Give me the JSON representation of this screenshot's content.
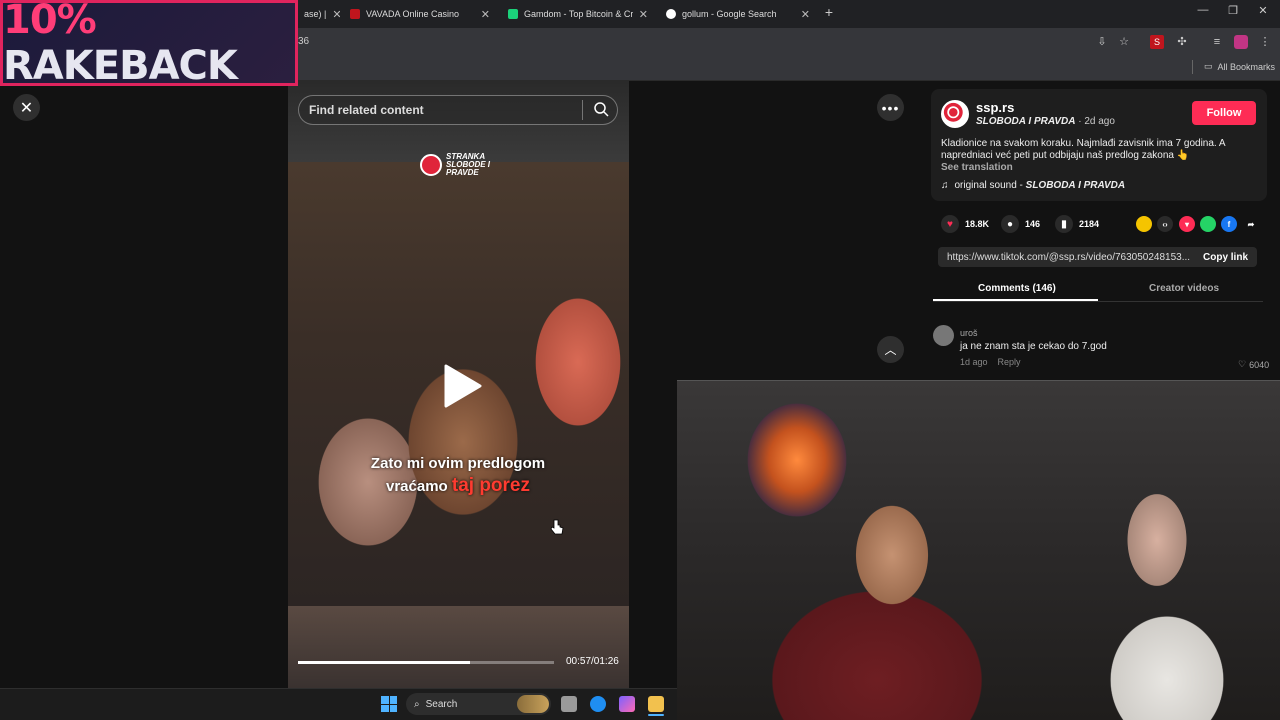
{
  "browser": {
    "tabs": [
      {
        "label": "ase) |",
        "active": false
      },
      {
        "label": "VAVADA Online Casino",
        "active": false
      },
      {
        "label": "Gamdom - Top Bitcoin & Crypto",
        "active": false
      },
      {
        "label": "gollum - Google Search",
        "active": true
      }
    ],
    "new_tab": "+",
    "url_fragment": "36",
    "bookmarks_label": "All Bookmarks"
  },
  "overlay": {
    "rakeback_pct": "10%",
    "rakeback_word": "RAKEBACK"
  },
  "video": {
    "search_placeholder": "Find related content",
    "logo_lines": [
      "STRANKA",
      "SLOBODE I",
      "PRAVDE"
    ],
    "subtitle_line1": "Zato mi ovim predlogom",
    "subtitle_line2_a": "vraćamo",
    "subtitle_line2_b": "taj porez",
    "time": "00:57/01:26",
    "progress": 0.67
  },
  "post": {
    "author": "ssp.rs",
    "nickname": "SLOBODA I PRAVDA",
    "posted": "· 2d ago",
    "follow_label": "Follow",
    "description": "Kladionice na svakom koraku. Najmlađi zavisnik ima 7 godina. A napredniaci već peti put odbijaju naš predlog zakona 👆",
    "see_translation": "See translation",
    "sound_prefix": "original sound -",
    "likes": "18.8K",
    "comments": "146",
    "saves": "2184",
    "link": "https://www.tiktok.com/@ssp.rs/video/763050248153...",
    "copy_link": "Copy link",
    "tab_comments": "Comments (146)",
    "tab_creator": "Creator videos"
  },
  "comment": {
    "user": "uroš",
    "text": "ja ne znam sta je cekao do 7.god",
    "age": "1d ago",
    "reply": "Reply",
    "likes": "6040"
  },
  "taskbar": {
    "search_label": "Search"
  },
  "colors": {
    "accent": "#fe2c55",
    "overlay_border": "#e0245e"
  }
}
